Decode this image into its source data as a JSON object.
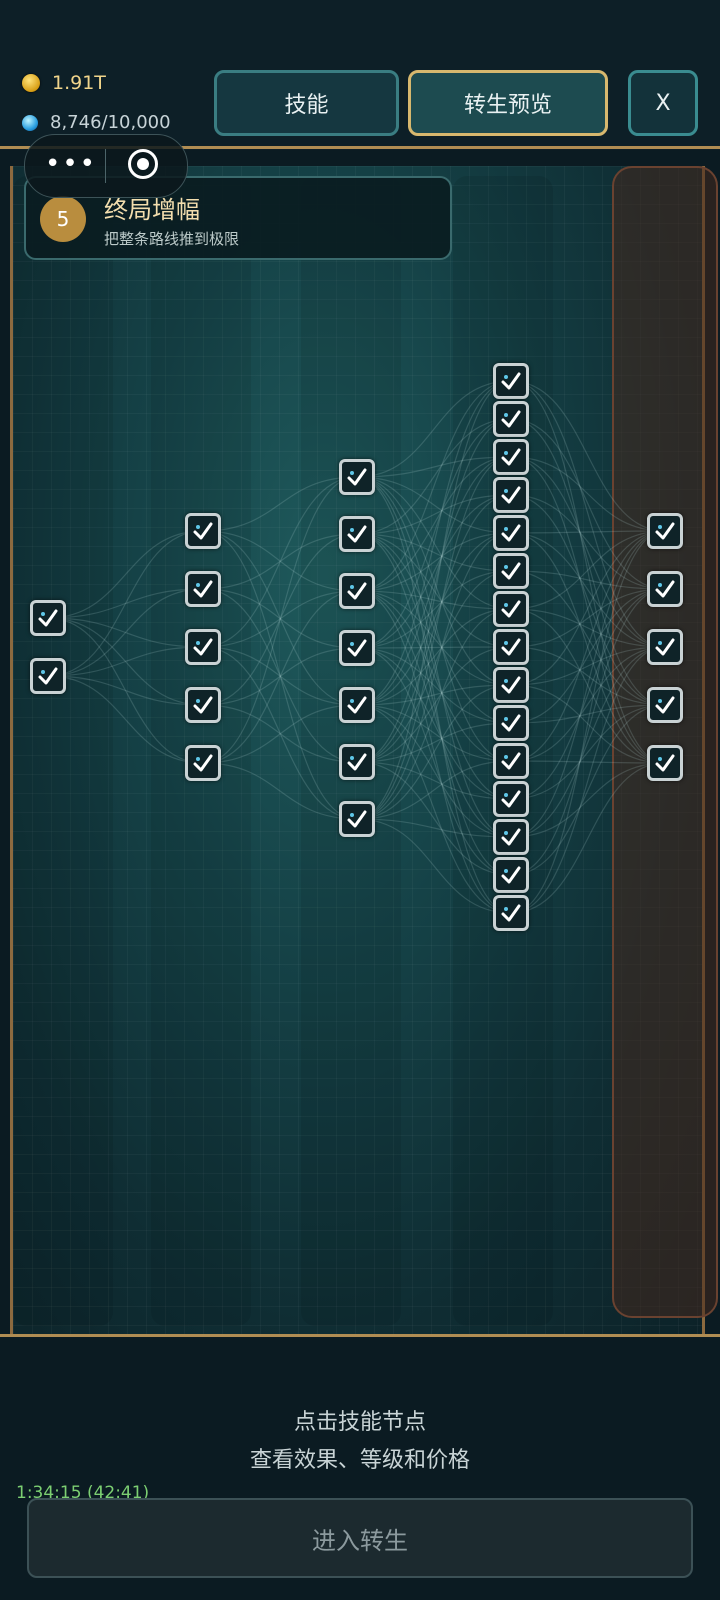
{
  "resources": {
    "gold": {
      "icon": "coin-icon",
      "value": "1.91T"
    },
    "gems": {
      "icon": "gem-icon",
      "value": "8,746/10,000"
    }
  },
  "tabs": {
    "skill": "技能",
    "preview": "转生预览",
    "close": "X"
  },
  "tier": {
    "number": "5",
    "title": "终局增幅",
    "subtitle": "把整条路线推到极限"
  },
  "columns": [
    {
      "nodes": 2,
      "state": "checked"
    },
    {
      "nodes": 5,
      "state": "checked"
    },
    {
      "nodes": 7,
      "state": "checked"
    },
    {
      "nodes": 15,
      "state": "checked"
    },
    {
      "nodes": 5,
      "state": "checked"
    }
  ],
  "hint": {
    "line1": "点击技能节点",
    "line2": "查看效果、等级和价格"
  },
  "timer": "1:34:15 (42:41)",
  "enter_button": "进入转生",
  "colors": {
    "accent_gold": "#d7b86e",
    "teal_border": "#3a7d82",
    "check": "#ffffff"
  }
}
